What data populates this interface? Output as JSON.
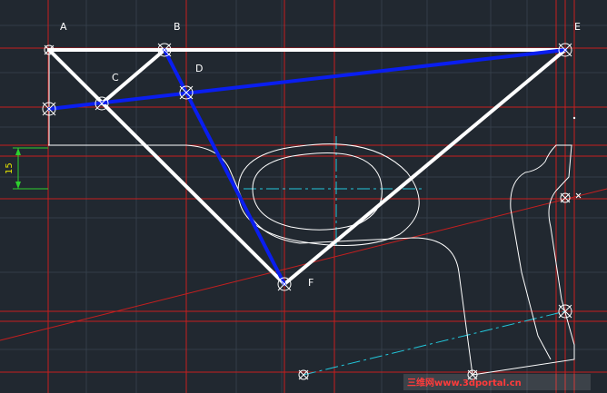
{
  "canvas": {
    "background": "#212830",
    "grid_color": "#3a4450",
    "construction_color": "#c81e1e",
    "geometry_white": "#ffffff",
    "linkage_blue": "#0a1ef0",
    "centerline_cyan": "#22c8dc",
    "dimension_green": "#2ed12e",
    "dimension_text_color": "#e8e800"
  },
  "points": {
    "A": "A",
    "B": "B",
    "C": "C",
    "D": "D",
    "E": "E",
    "F": "F"
  },
  "dimension": {
    "value": "15"
  },
  "watermark": {
    "text": "三维网www.3dportal.cn",
    "color": "#ff3b3b"
  },
  "icons": [
    "point-marker-icon",
    "snap-marker-icon"
  ]
}
